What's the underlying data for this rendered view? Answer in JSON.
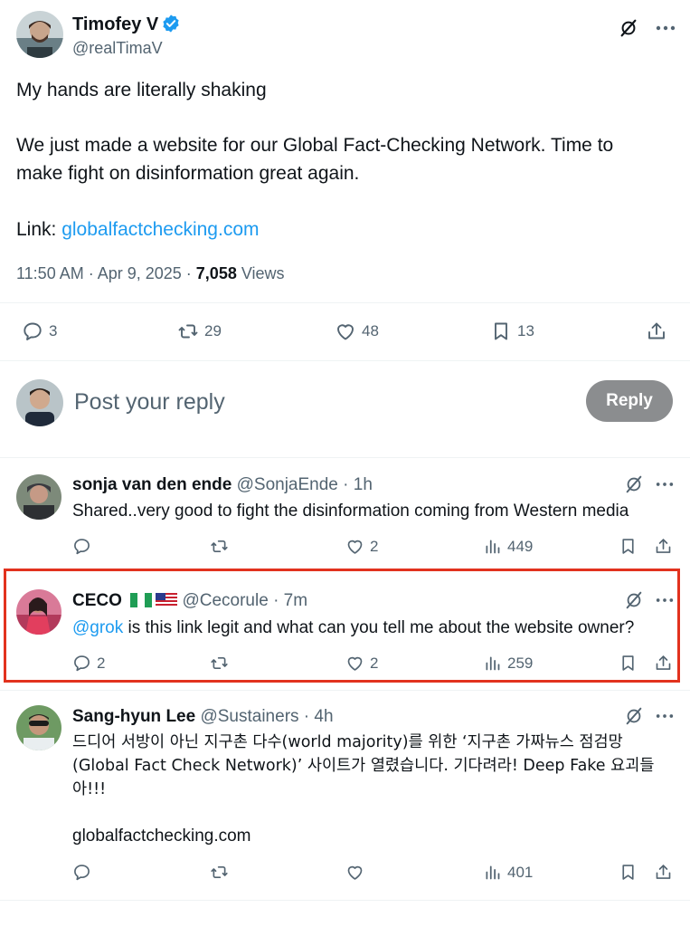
{
  "main_tweet": {
    "author_name": "Timofey V",
    "author_handle": "@realTimaV",
    "text_line1": "My hands are literally shaking",
    "text_line2": "We just made a website for our Global Fact-Checking Network. Time to",
    "text_line3": "make fight on disinformation great again.",
    "link_label": "Link: ",
    "link_text": "globalfactchecking.com",
    "time": "11:50 AM · Apr 9, 2025 · ",
    "views_count": "7,058",
    "views_label": " Views",
    "replies": "3",
    "retweets": "29",
    "likes": "48",
    "bookmarks": "13"
  },
  "composer": {
    "placeholder": "Post your reply",
    "button_label": "Reply"
  },
  "replies": [
    {
      "name": "sonja van den ende",
      "meta": " @SonjaEnde · 1h",
      "text": "Shared..very good to fight the disinformation coming from Western media",
      "replies": "",
      "likes": "2",
      "views": "449"
    },
    {
      "name": "CECO",
      "meta": " @Cecorule · 7m",
      "mention": "@grok",
      "text": " is this link legit and what can you tell me about the website owner?",
      "replies": "2",
      "likes": "2",
      "views": "259"
    },
    {
      "name": "Sang-hyun Lee",
      "meta": " @Sustainers · 4h",
      "text_line1": "드디어 서방이 아닌 지구촌 다수(world majority)를 위한 ‘지구촌 가짜뉴스 점검망",
      "text_line2": "(Global Fact Check Network)’ 사이트가 열렸습니다. 기다려라! Deep Fake 요괴들",
      "text_line3": "아!!!",
      "link_text": "globalfactchecking.com",
      "replies": "",
      "likes": "",
      "views": "401"
    }
  ],
  "colors": {
    "accent": "#1d9bf0",
    "secondary_text": "#536471",
    "highlight_border": "#e2321e",
    "reply_button": "#8b8d8f"
  },
  "icons": [
    "verified-badge-icon",
    "grok-icon",
    "more-icon",
    "reply-icon",
    "retweet-icon",
    "like-icon",
    "views-icon",
    "bookmark-icon",
    "share-icon"
  ]
}
